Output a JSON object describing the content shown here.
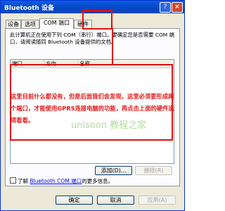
{
  "window": {
    "title": "Bluetooth 设备",
    "help": "?",
    "close": "×"
  },
  "tabs": [
    "设备",
    "选项",
    "COM 端口",
    "硬件"
  ],
  "description": "此计算机正在使用下列 COM（串行）端口。要确定您是否需要 COM 端口，请阅读随同 Bluetooth 设备提供的文档。",
  "table": {
    "columns": [
      "端口",
      "方向",
      "名称"
    ]
  },
  "buttons": {
    "add": "添加(D)...",
    "remove": "删除(R)",
    "ok": "确定",
    "cancel": "取消",
    "apply": "应用(A)"
  },
  "info": {
    "prefix": "了解",
    "link": "Bluetooth COM 端口",
    "suffix": "的更多信息。"
  },
  "annotation": "这里目前什么都没有，但是后面我们会发现，这里必须要形成两个端口，才能使用GPRS连接电脑的功能，再点击上面的硬件选项看看。",
  "watermark": "unisoon 教程之家",
  "colors": {
    "titlebar": "#0546c7",
    "annotation": "#e01818",
    "highlight_box": "#d11111"
  }
}
